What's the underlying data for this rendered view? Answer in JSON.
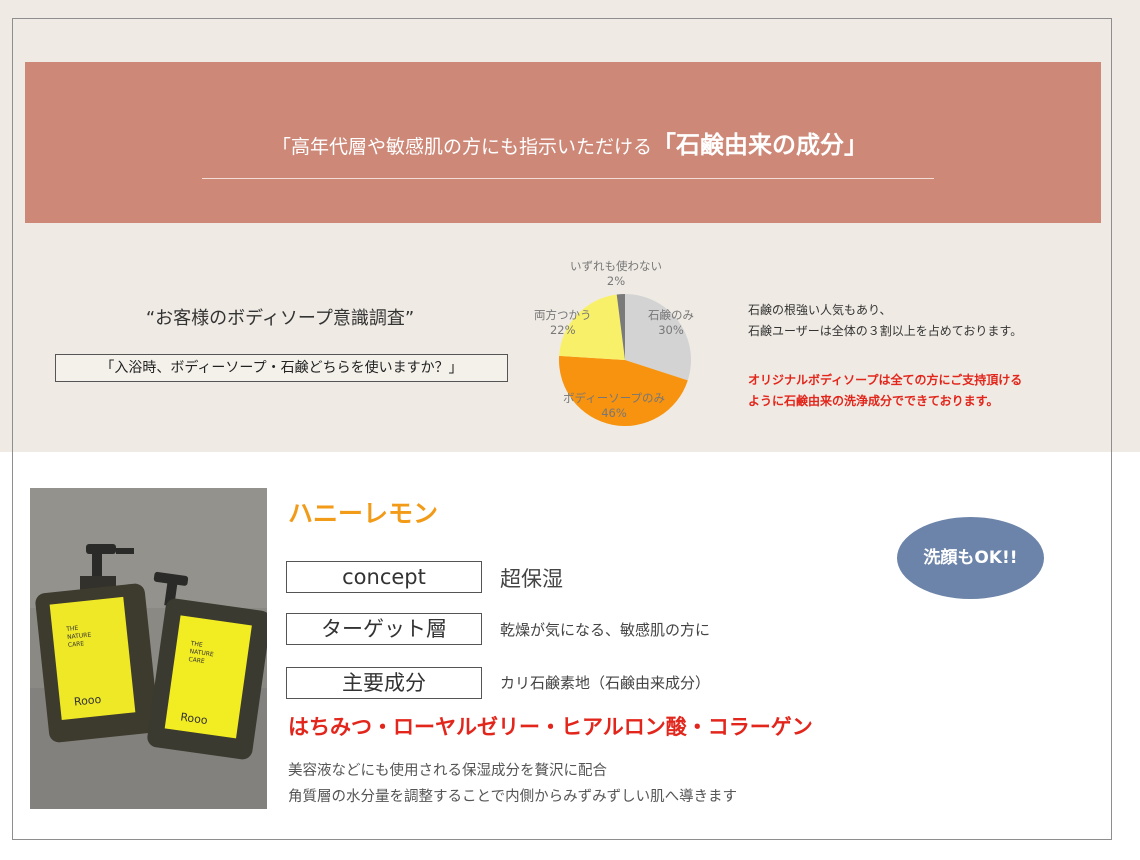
{
  "banner": {
    "title_prefix": "「高年代層や敏感肌の方にも指示いただける",
    "title_emphasis": "「石鹸由来の成分」"
  },
  "survey": {
    "title": "“お客様のボディソープ意識調査”",
    "question": "「入浴時、ボディーソープ・石鹸どちらを使いますか？」",
    "note_lines": [
      "石鹸の根強い人気もあり、",
      "石鹸ユーザーは全体の３割以上を占めております。"
    ],
    "highlight_lines": [
      "オリジナルボディソープは全ての方にご支持頂ける",
      "ように石鹸由来の洗浄成分でできております。"
    ]
  },
  "chart_data": {
    "type": "pie",
    "categories": [
      "石鹸のみ",
      "ボディーソープのみ",
      "両方つかう",
      "いずれも使わない"
    ],
    "values": [
      30,
      46,
      22,
      2
    ],
    "labels": [
      "30%",
      "46%",
      "22%",
      "2%"
    ],
    "colors": [
      "#d3d3d3",
      "#f7930e",
      "#f9f06a",
      "#7a7a7a"
    ]
  },
  "product": {
    "name": "ハニーレモン",
    "badge": "洗顔もOK!!",
    "specs": [
      {
        "label": "concept",
        "value": "超保湿"
      },
      {
        "label": "ターゲット層",
        "value": "乾燥が気になる、敏感肌の方に"
      },
      {
        "label": "主要成分",
        "value": "カリ石鹸素地（石鹸由来成分）"
      }
    ],
    "ingredients": "はちみつ・ローヤルゼリー・ヒアルロン酸・コラーゲン",
    "description": [
      "美容液などにも使用される保湿成分を贅沢に配合",
      "角質層の水分量を調整することで内側からみずみずしい肌へ導きます"
    ],
    "photo_label": {
      "brand_lines": [
        "THE",
        "NATURE",
        "CARE"
      ],
      "logo": "Rooo"
    }
  }
}
